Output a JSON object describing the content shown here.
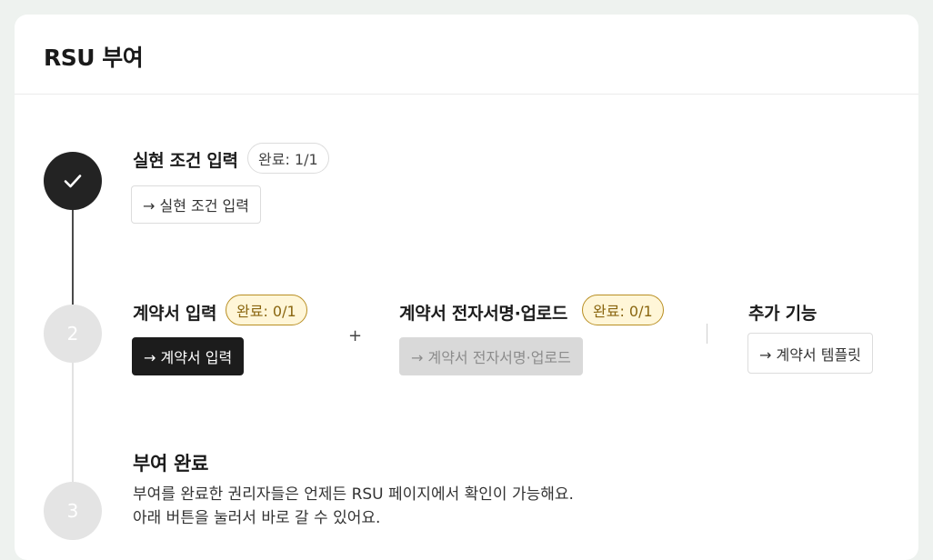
{
  "header": {
    "title": "RSU 부여"
  },
  "steps": [
    {
      "number": "",
      "state": "done",
      "title": "실현 조건 입력",
      "badge": "완료: 1/1",
      "button": "→ 실현 조건 입력"
    },
    {
      "number": "2",
      "state": "pending",
      "sections": [
        {
          "title": "계약서 입력",
          "badge": "완료: 0/1",
          "button": "→ 계약서 입력"
        },
        {
          "title": "계약서 전자서명·업로드",
          "badge": "완료: 0/1",
          "button": "→ 계약서 전자서명·업로드"
        }
      ],
      "plus": "+",
      "extra": {
        "title": "추가 기능",
        "button": "→ 계약서 템플릿"
      }
    },
    {
      "number": "3",
      "state": "pending",
      "title": "부여 완료",
      "desc_line1": "부여를 완료한 권리자들은 언제든 RSU 페이지에서 확인이 가능해요.",
      "desc_line2": "아래 버튼을 눌러서 바로 갈 수 있어요."
    }
  ]
}
